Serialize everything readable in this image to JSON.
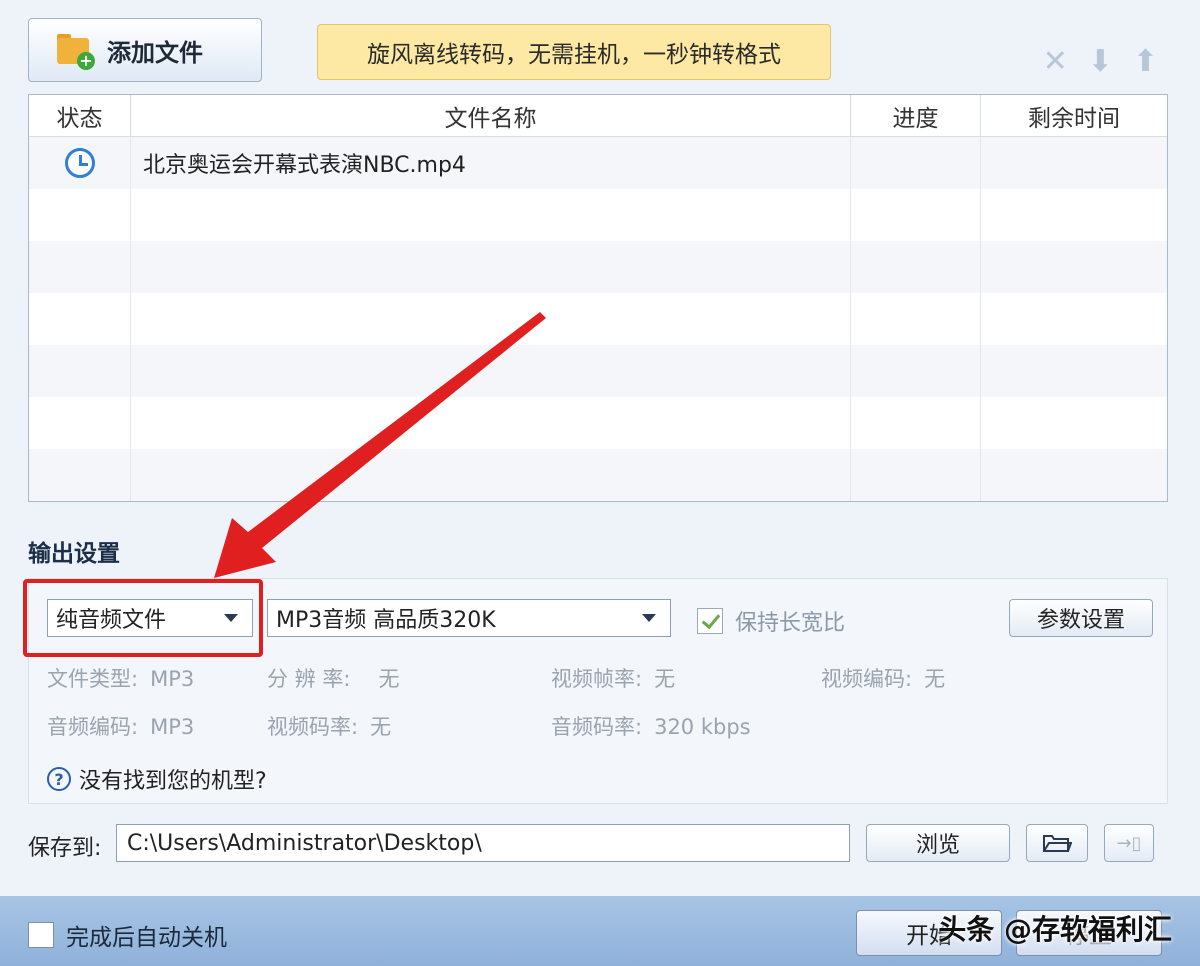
{
  "toolbar": {
    "add_file_label": "添加文件",
    "banner_text": "旋风离线转码，无需挂机，一秒钟转格式",
    "icons": [
      "close-icon",
      "arrow-down-icon",
      "arrow-up-icon"
    ]
  },
  "file_list": {
    "columns": [
      "状态",
      "文件名称",
      "进度",
      "剩余时间"
    ],
    "rows": [
      {
        "status_icon": "clock-icon",
        "name": "北京奥运会开幕式表演NBC.mp4",
        "progress": "",
        "remaining": ""
      }
    ]
  },
  "output": {
    "title": "输出设置",
    "category_selected": "纯音频文件",
    "preset_selected": "MP3音频 高品质320K",
    "keep_ratio_label": "保持长宽比",
    "keep_ratio_checked": true,
    "param_button": "参数设置",
    "info": {
      "file_type_label": "文件类型:",
      "file_type_value": "MP3",
      "resolution_label": "分 辨 率:",
      "resolution_value": "无",
      "video_fps_label": "视频帧率:",
      "video_fps_value": "无",
      "video_codec_label": "视频编码:",
      "video_codec_value": "无",
      "audio_codec_label": "音频编码:",
      "audio_codec_value": "MP3",
      "video_bitrate_label": "视频码率:",
      "video_bitrate_value": "无",
      "audio_bitrate_label": "音频码率:",
      "audio_bitrate_value": "320 kbps"
    },
    "help_text": "没有找到您的机型?"
  },
  "save": {
    "label": "保存到:",
    "path": "C:\\Users\\Administrator\\Desktop\\",
    "browse_button": "浏览"
  },
  "bottom": {
    "auto_shutdown_label": "完成后自动关机",
    "start_button": "开始",
    "stop_button": "停止",
    "watermark": "头条 @存软福利汇"
  },
  "colors": {
    "highlight_box": "#e02020",
    "banner_bg": "#fde9a3",
    "bottom_bar": "#9dbbe0"
  }
}
